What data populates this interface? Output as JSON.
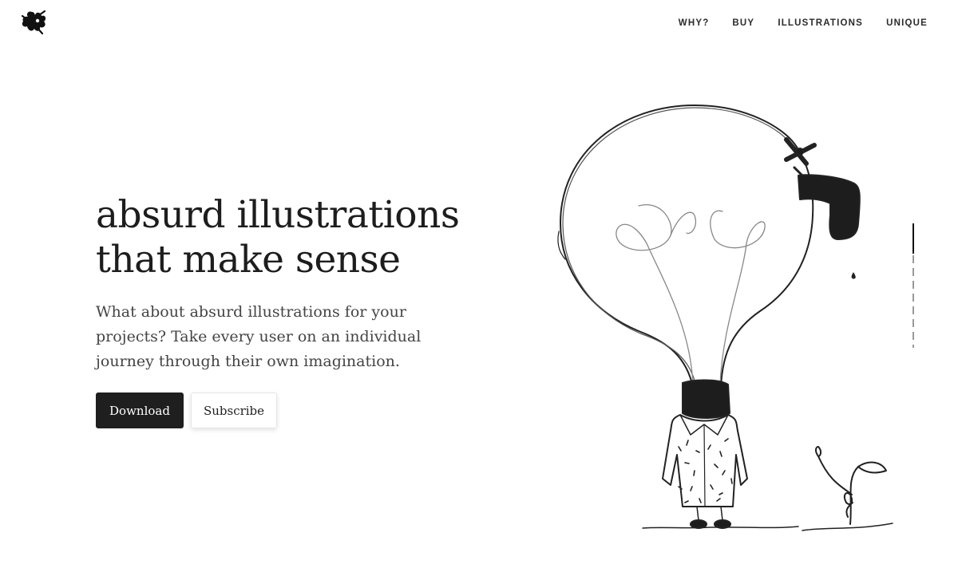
{
  "header": {
    "logo_icon": "absurd-splat-logo",
    "nav": [
      {
        "label": "WHY?"
      },
      {
        "label": "BUY"
      },
      {
        "label": "ILLUSTRATIONS"
      },
      {
        "label": "UNIQUE"
      }
    ]
  },
  "hero": {
    "title_line1": "absurd illustrations",
    "title_line2": "that make sense",
    "description": "What about absurd illustrations for your projects? Take every user on an individual journey through their own imagination."
  },
  "buttons": {
    "download_label": "Download",
    "subscribe_label": "Subscribe"
  },
  "illustration": {
    "icon": "lightbulb-person-faucet-illustration"
  },
  "colors": {
    "primary_button": "#1f1f1f",
    "text": "#222222",
    "background": "#ffffff"
  }
}
